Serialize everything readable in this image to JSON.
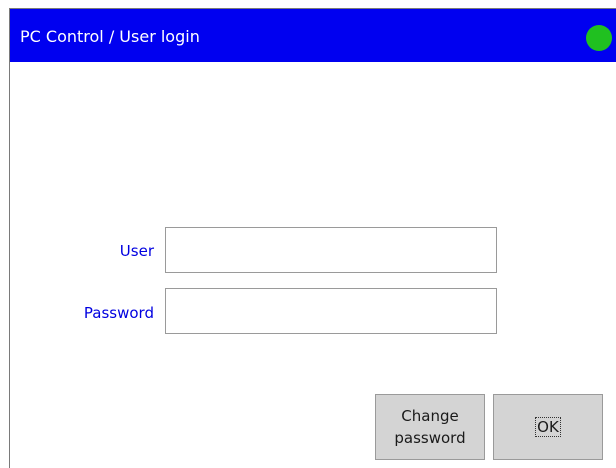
{
  "window": {
    "title": "PC Control / User login",
    "status_color": "#20c020",
    "titlebar_color": "#0000f0"
  },
  "form": {
    "user_label": "User",
    "user_value": "",
    "password_label": "Password",
    "password_value": ""
  },
  "buttons": {
    "change_password_label": "Change\npassword",
    "ok_label": "OK"
  }
}
